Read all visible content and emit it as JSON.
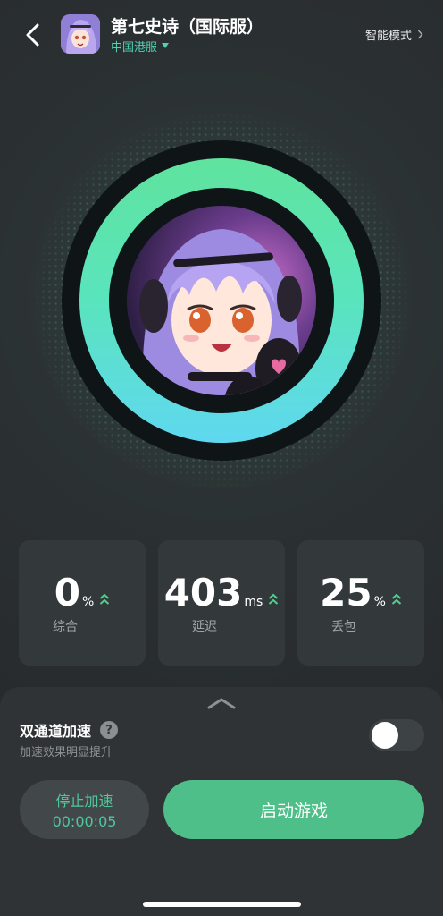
{
  "header": {
    "title": "第七史诗（国际服）",
    "server": "中国港服",
    "mode_link": "智能模式"
  },
  "stats": [
    {
      "value": "0",
      "unit": "%",
      "label": "综合"
    },
    {
      "value": "403",
      "unit": "ms",
      "label": "延迟"
    },
    {
      "value": "25",
      "unit": "%",
      "label": "丢包"
    }
  ],
  "sheet": {
    "dual_channel_title": "双通道加速",
    "dual_channel_help": "?",
    "dual_channel_subtitle": "加速效果明显提升",
    "dual_channel_enabled": false,
    "stop_label": "停止加速",
    "timer": "00:00:05",
    "launch_label": "启动游戏"
  },
  "icons": {
    "back": "chevron-left-icon",
    "server_dropdown": "caret-down-icon",
    "mode_arrow": "chevron-right-icon",
    "stat_arrow": "double-chevron-up-icon",
    "handle": "chevron-up-icon"
  },
  "colors": {
    "accent": "#4fbf8a",
    "server_text": "#4fd1b5",
    "ring_top": "#5fe39e",
    "ring_bottom": "#5fd8f0",
    "arrow_green": "#4fd08e"
  }
}
